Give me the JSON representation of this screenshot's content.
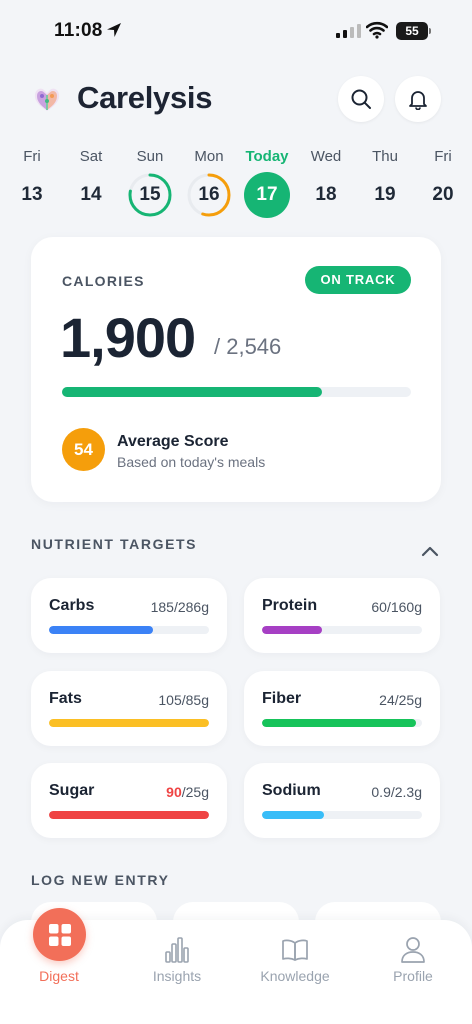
{
  "status_bar": {
    "time": "11:08",
    "battery": "55"
  },
  "header": {
    "app_name": "Carelysis",
    "icons": [
      "app-logo",
      "search-icon",
      "bell-icon"
    ]
  },
  "date_strip": [
    {
      "day": "Fri",
      "num": "13",
      "state": "plain"
    },
    {
      "day": "Sat",
      "num": "14",
      "state": "plain"
    },
    {
      "day": "Sun",
      "num": "15",
      "state": "ring",
      "ring_color": "#16b574",
      "ring_progress": 0.78
    },
    {
      "day": "Mon",
      "num": "16",
      "state": "ring",
      "ring_color": "#f59e0b",
      "ring_progress": 0.55
    },
    {
      "day": "Today",
      "num": "17",
      "state": "today"
    },
    {
      "day": "Wed",
      "num": "18",
      "state": "plain"
    },
    {
      "day": "Thu",
      "num": "19",
      "state": "plain"
    },
    {
      "day": "Fri",
      "num": "20",
      "state": "plain"
    }
  ],
  "calories": {
    "label": "CALORIES",
    "badge": "ON TRACK",
    "value": "1,900",
    "target": "/ 2,546",
    "progress": 0.746,
    "score": "54",
    "score_title": "Average Score",
    "score_subtitle": "Based on today's meals"
  },
  "nutrients": {
    "title": "NUTRIENT TARGETS",
    "items": [
      {
        "name": "Carbs",
        "value": "185/286g",
        "over_value": "",
        "over_rest": "",
        "progress": 0.65,
        "color": "#3b82f6"
      },
      {
        "name": "Protein",
        "value": "60/160g",
        "over_value": "",
        "over_rest": "",
        "progress": 0.375,
        "color": "#a63fc4"
      },
      {
        "name": "Fats",
        "value": "105/85g",
        "over_value": "",
        "over_rest": "",
        "progress": 1.0,
        "color": "#fbbf24"
      },
      {
        "name": "Fiber",
        "value": "24/25g",
        "over_value": "",
        "over_rest": "",
        "progress": 0.96,
        "color": "#16c35a"
      },
      {
        "name": "Sugar",
        "value": "",
        "over_value": "90",
        "over_rest": "/25g",
        "progress": 1.0,
        "color": "#ef4444"
      },
      {
        "name": "Sodium",
        "value": "0.9/2.3g",
        "over_value": "",
        "over_rest": "",
        "progress": 0.39,
        "color": "#38bdf8"
      }
    ]
  },
  "log_entry": {
    "title": "LOG NEW ENTRY"
  },
  "tabs": [
    {
      "label": "Digest",
      "active": true
    },
    {
      "label": "Insights",
      "active": false
    },
    {
      "label": "Knowledge",
      "active": false
    },
    {
      "label": "Profile",
      "active": false
    }
  ],
  "colors": {
    "accent_green": "#16b574",
    "accent_coral": "#f26f59",
    "score_orange": "#f59e0b"
  }
}
